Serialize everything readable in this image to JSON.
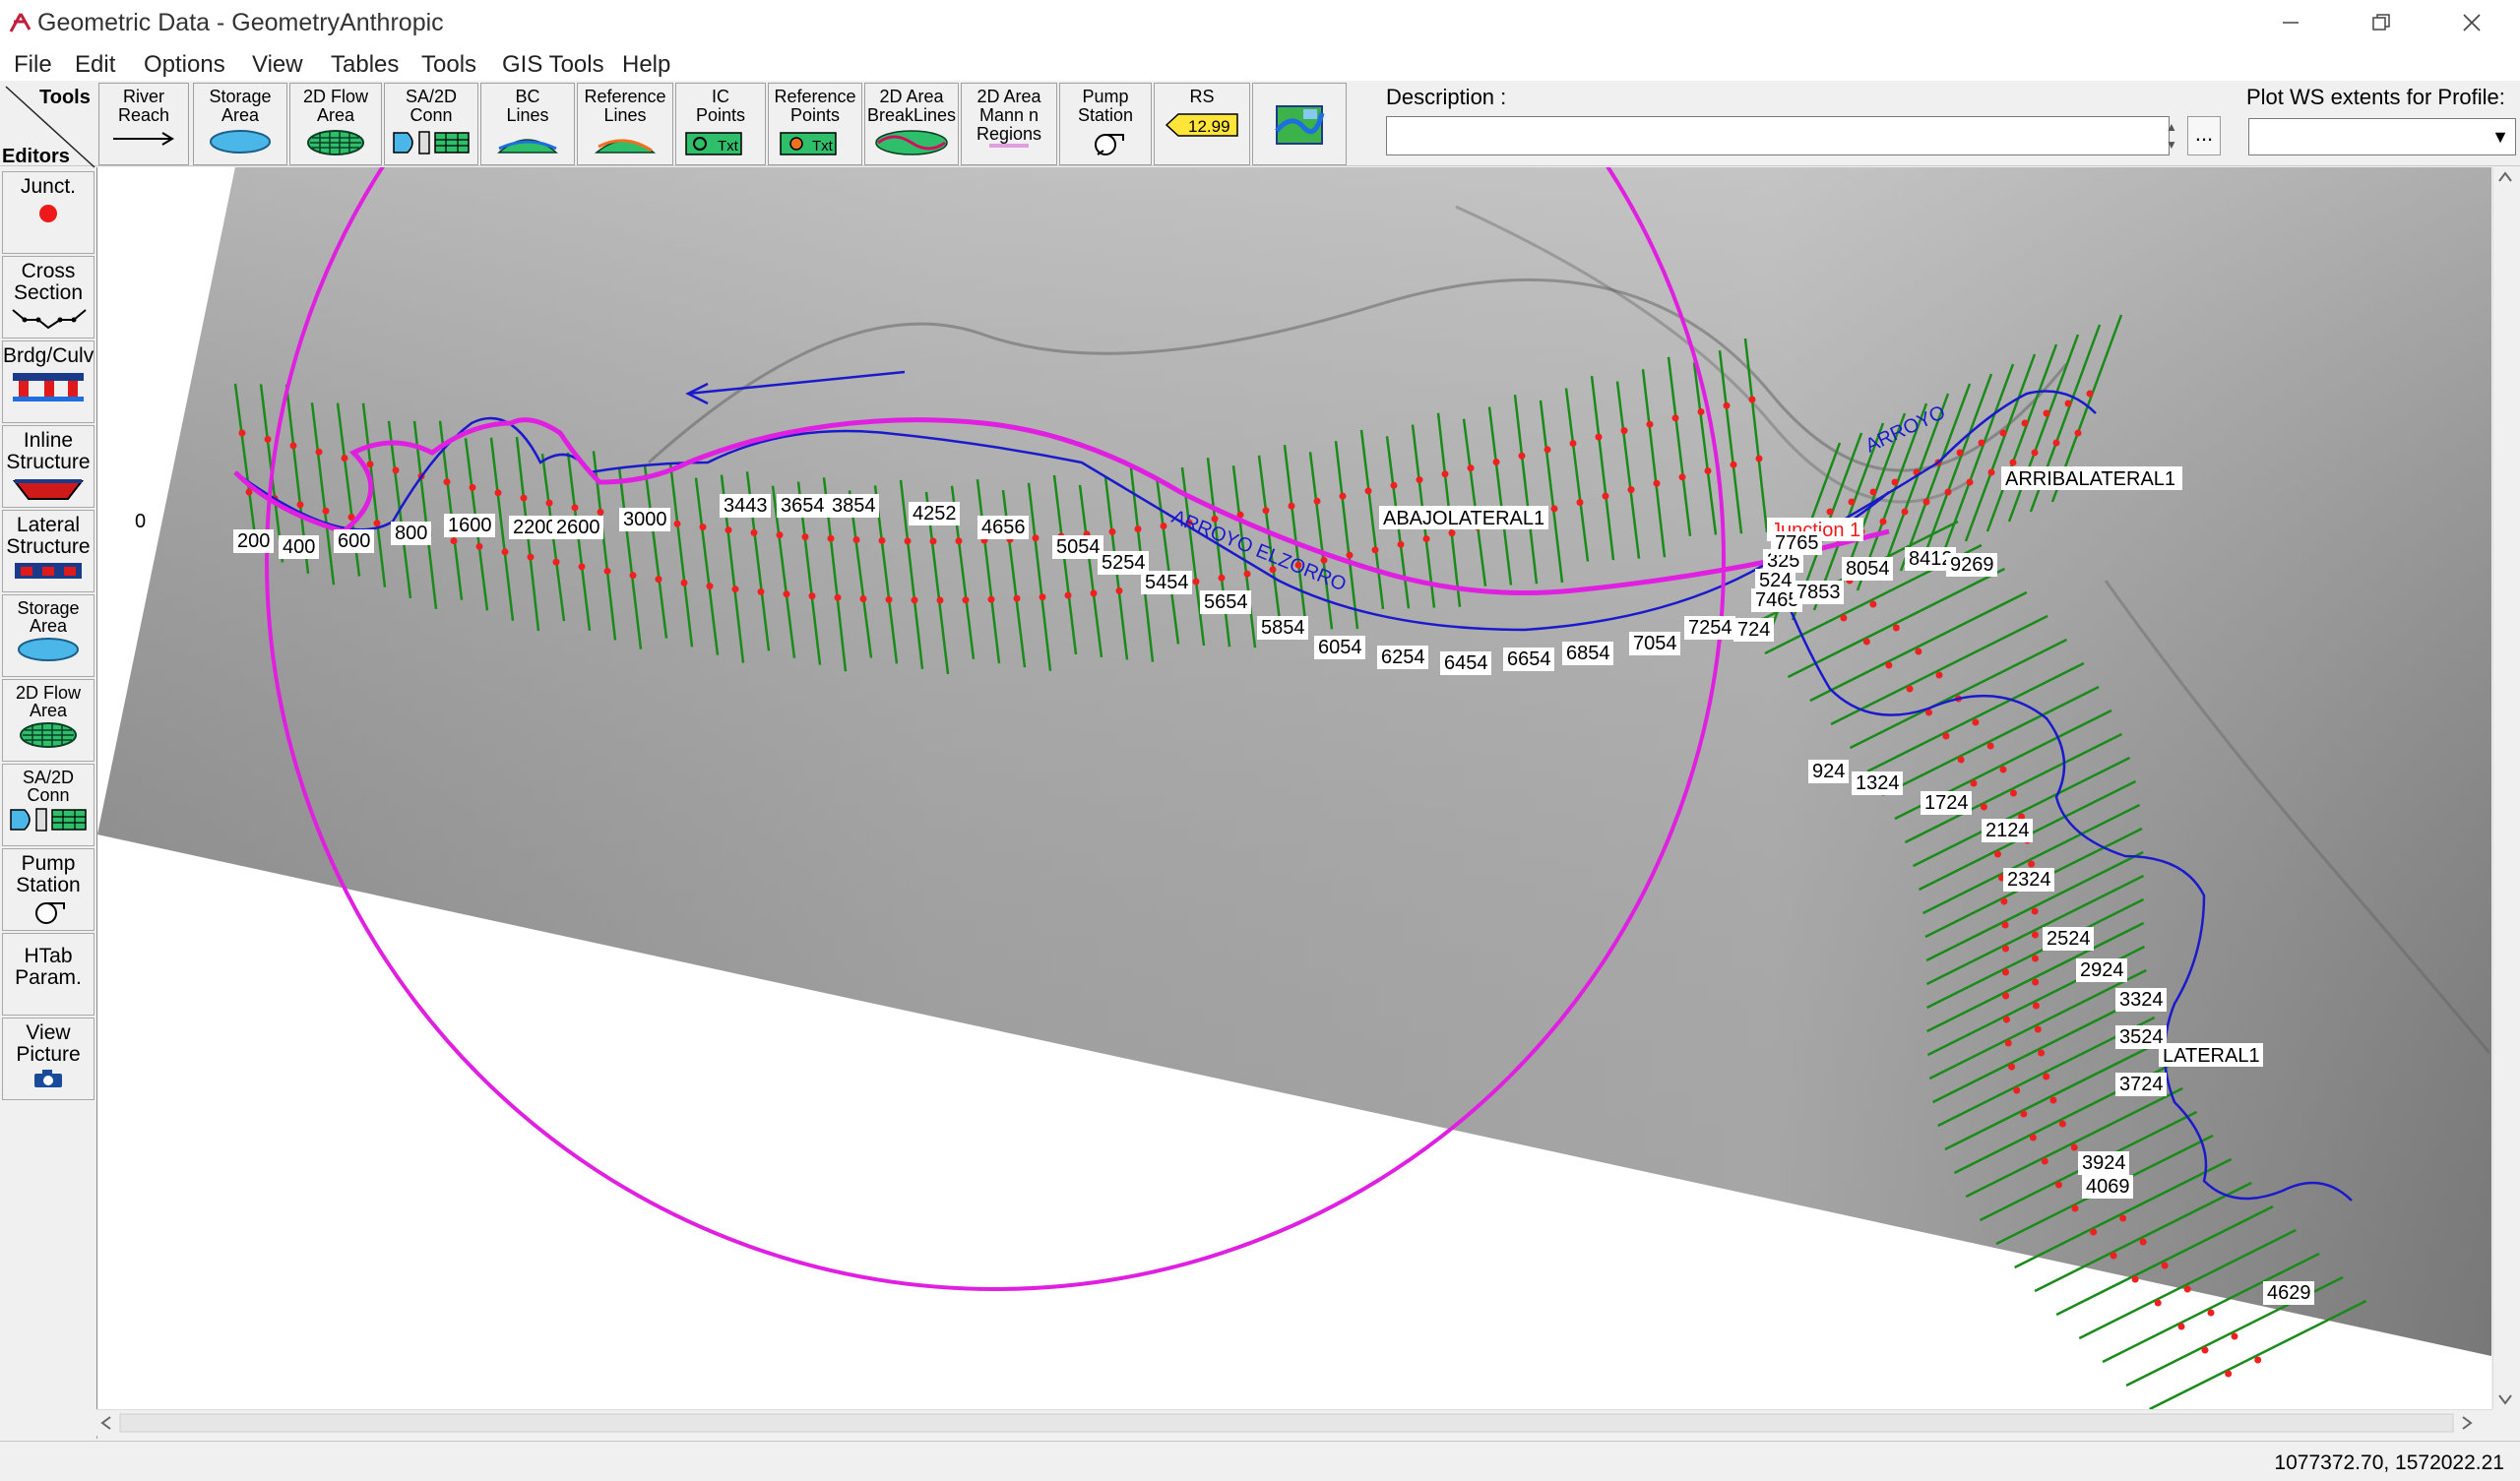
{
  "window": {
    "title": "Geometric Data - GeometryAnthropic",
    "minimize_icon": "minimize-icon",
    "maximize_icon": "restore-icon",
    "close_icon": "close-icon"
  },
  "menu": [
    "File",
    "Edit",
    "Options",
    "View",
    "Tables",
    "Tools",
    "GIS Tools",
    "Help"
  ],
  "toolbar": {
    "tools_label": "Tools",
    "editors_label": "Editors",
    "buttons": [
      {
        "label": "River\nReach",
        "icon": "river-reach-icon"
      },
      {
        "label": "Storage\nArea",
        "icon": "storage-area-icon"
      },
      {
        "label": "2D Flow\nArea",
        "icon": "2d-flow-area-icon"
      },
      {
        "label": "SA/2D\nConn",
        "icon": "sa-2d-conn-icon"
      },
      {
        "label": "BC\nLines",
        "icon": "bc-lines-icon"
      },
      {
        "label": "Reference\nLines",
        "icon": "reference-lines-icon"
      },
      {
        "label": "IC\nPoints",
        "icon": "ic-points-icon"
      },
      {
        "label": "Reference\nPoints",
        "icon": "reference-points-icon"
      },
      {
        "label": "2D Area\nBreakLines",
        "icon": "breaklines-icon"
      },
      {
        "label": "2D Area\nMann n\nRegions",
        "icon": "mann-n-regions-icon"
      },
      {
        "label": "Pump\nStation",
        "icon": "pump-station-icon"
      },
      {
        "label": "RS",
        "icon": "rs-tag-icon",
        "tag_value": "12.99"
      },
      {
        "label": "",
        "icon": "map-background-icon"
      }
    ],
    "description_label": "Description :",
    "description_value": "",
    "ellipsis": "...",
    "plot_label": "Plot WS extents for Profile:",
    "plot_value": ""
  },
  "sidebar": [
    {
      "label": "Junct.",
      "icon": "junction-icon"
    },
    {
      "label": "Cross\nSection",
      "icon": "cross-section-icon"
    },
    {
      "label": "Brdg/Culv",
      "icon": "bridge-culvert-icon"
    },
    {
      "label": "Inline\nStructure",
      "icon": "inline-structure-icon"
    },
    {
      "label": "Lateral\nStructure",
      "icon": "lateral-structure-icon"
    },
    {
      "label": "Storage\nArea",
      "icon": "storage-area-icon"
    },
    {
      "label": "2D Flow\nArea",
      "icon": "2d-flow-area-icon"
    },
    {
      "label": "SA/2D\nConn",
      "icon": "sa-2d-conn-icon"
    },
    {
      "label": "Pump\nStation",
      "icon": "pump-station-icon"
    },
    {
      "label": "HTab\nParam.",
      "icon": ""
    },
    {
      "label": "View\nPicture",
      "icon": "camera-icon"
    }
  ],
  "map": {
    "colors": {
      "terrain": "#9a9a9a",
      "xs": "#1a8a1a",
      "centerline": "#1a1acc",
      "profile": "#e020e0",
      "node": "#ee2020"
    },
    "reach_labels": [
      "ABAJOLATERAL1",
      "ARRIBALATERAL1",
      "LATERAL1"
    ],
    "river_labels": [
      "ARROYO ELZORRO",
      "ARROYO"
    ],
    "junction_label": "Junction 1",
    "main_rs": [
      "0",
      "200",
      "400",
      "600",
      "800",
      "1600",
      "2200",
      "2600",
      "3000",
      "3443",
      "3654",
      "3854",
      "4252",
      "4656",
      "5054",
      "5254",
      "5454",
      "5654",
      "5854",
      "6054",
      "6254",
      "6454",
      "6654",
      "6854",
      "7054",
      "7254",
      "724",
      "7465",
      "524",
      "325",
      "7765"
    ],
    "upper_rs": [
      "7853",
      "8054",
      "8412",
      "9269"
    ],
    "lateral_rs": [
      "924",
      "1324",
      "1724",
      "2124",
      "2324",
      "2524",
      "2924",
      "3324",
      "3524",
      "3724",
      "3924",
      "4069",
      "4629"
    ]
  },
  "status": {
    "coordinates": "1077372.70, 1572022.21"
  }
}
